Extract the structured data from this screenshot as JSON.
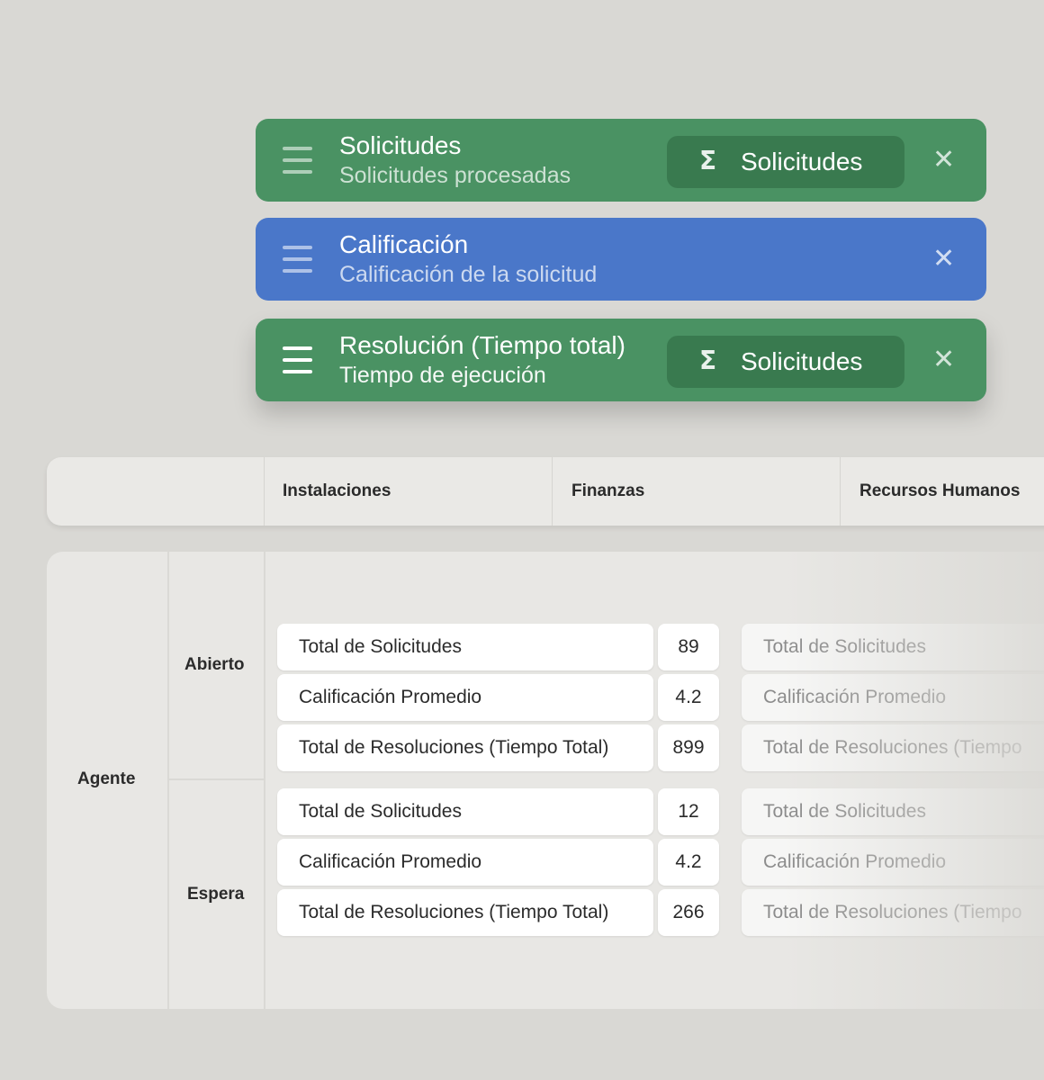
{
  "cards": [
    {
      "title": "Solicitudes",
      "subtitle": "Solicitudes procesadas",
      "aggregate_icon": "Σ",
      "aggregate_label": "Solicitudes",
      "color": "#4a9263"
    },
    {
      "title": "Calificación",
      "subtitle": "Calificación de la solicitud",
      "color": "#4a77c9"
    },
    {
      "title": "Resolución (Tiempo total)",
      "subtitle": "Tiempo de ejecución",
      "aggregate_icon": "Σ",
      "aggregate_label": "Solicitudes",
      "color": "#4a9263"
    }
  ],
  "close_glyph": "✕",
  "columns": [
    "Instalaciones",
    "Finanzas",
    "Recursos Humanos"
  ],
  "row_header": "Agente",
  "groups": [
    {
      "name": "Abierto",
      "rows": [
        {
          "label": "Total de Solicitudes",
          "value": "89"
        },
        {
          "label": "Calificación Promedio",
          "value": "4.2"
        },
        {
          "label": "Total de Resoluciones (Tiempo Total)",
          "value": "899"
        }
      ]
    },
    {
      "name": "Espera",
      "rows": [
        {
          "label": "Total de Solicitudes",
          "value": "12"
        },
        {
          "label": "Calificación Promedio",
          "value": "4.2"
        },
        {
          "label": "Total de Resoluciones (Tiempo Total)",
          "value": "266"
        }
      ]
    }
  ],
  "faded_rows": [
    "Total de Solicitudes",
    "Calificación Promedio",
    "Total de Resoluciones (Tiempo",
    "Total de Solicitudes",
    "Calificación Promedio",
    "Total de Resoluciones (Tiempo"
  ]
}
